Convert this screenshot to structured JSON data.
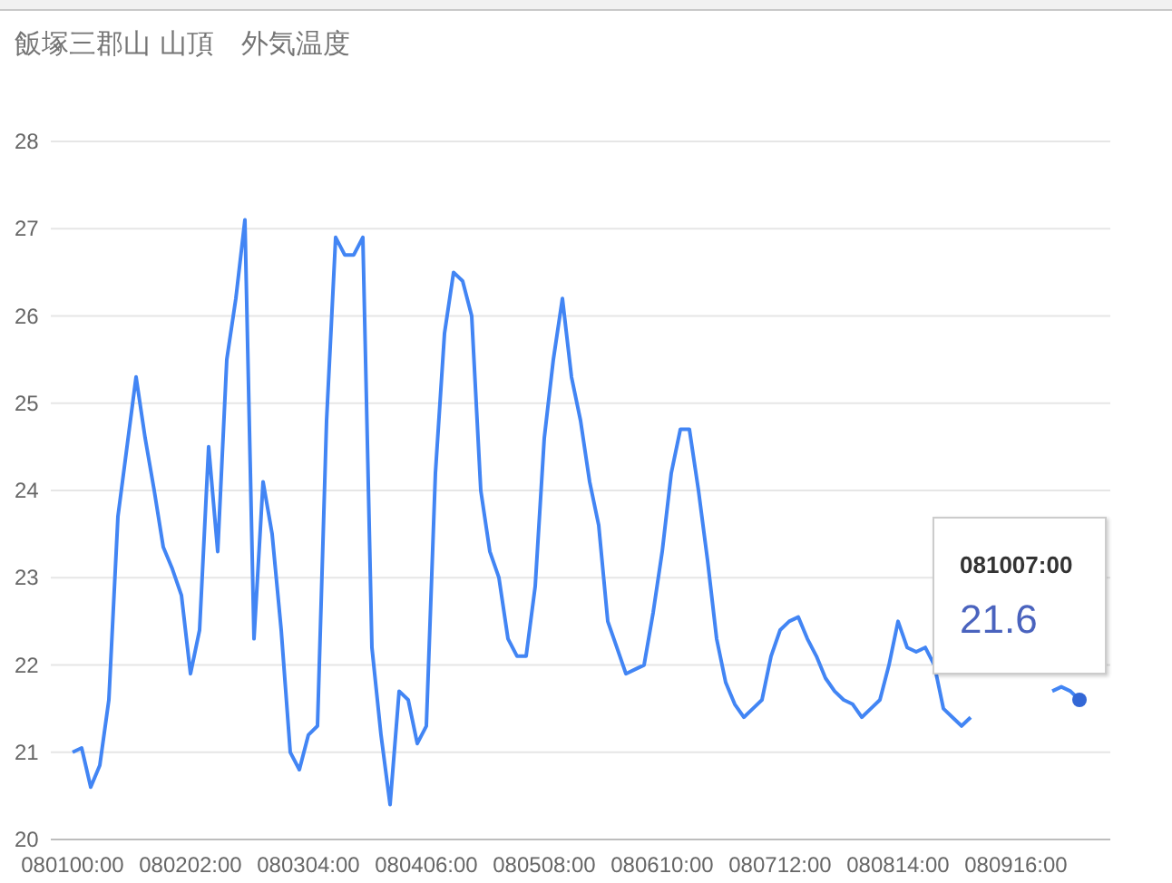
{
  "title": "飯塚三郡山 山頂　外気温度",
  "chart": {
    "chart_data": {
      "type": "line",
      "categories": [
        "080100:00",
        null,
        null,
        null,
        null,
        null,
        null,
        null,
        null,
        null,
        null,
        null,
        null,
        "080202:00",
        null,
        null,
        null,
        null,
        null,
        null,
        null,
        null,
        null,
        null,
        null,
        null,
        "080304:00",
        null,
        null,
        null,
        null,
        null,
        null,
        null,
        null,
        null,
        null,
        null,
        null,
        "080406:00",
        null,
        null,
        null,
        null,
        null,
        null,
        null,
        null,
        null,
        null,
        null,
        null,
        "080508:00",
        null,
        null,
        null,
        null,
        null,
        null,
        null,
        null,
        null,
        null,
        null,
        null,
        "080610:00",
        null,
        null,
        null,
        null,
        null,
        null,
        null,
        null,
        null,
        null,
        null,
        null,
        "080712:00",
        null,
        null,
        null,
        null,
        null,
        null,
        null,
        null,
        null,
        null,
        null,
        null,
        "080814:00",
        null,
        null,
        null,
        null,
        null,
        null,
        null,
        null,
        null,
        null,
        null,
        null,
        "080916:00",
        null,
        null,
        null,
        null,
        null,
        null,
        null
      ],
      "series": [
        {
          "color": "#4285f4",
          "values": [
            21.0,
            21.05,
            20.6,
            20.85,
            21.6,
            23.7,
            24.5,
            25.3,
            24.6,
            24.0,
            23.35,
            23.1,
            22.8,
            21.9,
            22.4,
            24.5,
            23.3,
            25.5,
            26.2,
            27.1,
            22.3,
            24.1,
            23.5,
            22.4,
            21.0,
            20.8,
            21.2,
            21.3,
            24.8,
            26.9,
            26.7,
            26.7,
            26.9,
            22.2,
            21.2,
            20.4,
            21.7,
            21.6,
            21.1,
            21.3,
            24.2,
            25.8,
            26.5,
            26.4,
            26.0,
            24.0,
            23.3,
            23.0,
            22.3,
            22.1,
            22.1,
            22.9,
            24.6,
            25.5,
            26.2,
            25.3,
            24.8,
            24.1,
            23.6,
            22.5,
            22.2,
            21.9,
            21.95,
            22.0,
            22.6,
            23.3,
            24.2,
            24.7,
            24.7,
            24.0,
            23.2,
            22.3,
            21.8,
            21.55,
            21.4,
            21.5,
            21.6,
            22.1,
            22.4,
            22.5,
            22.55,
            22.3,
            22.1,
            21.85,
            21.7,
            21.6,
            21.55,
            21.4,
            21.5,
            21.6,
            22.0,
            22.5,
            22.2,
            22.15,
            22.2,
            22.0,
            21.5,
            21.4,
            21.3,
            21.4,
            null,
            null,
            null,
            null,
            null,
            null,
            null,
            null,
            21.7,
            21.75,
            21.7,
            21.6
          ]
        }
      ],
      "ylim": [
        20,
        28
      ],
      "grid": true,
      "yticks": [
        20,
        21,
        22,
        23,
        24,
        25,
        26,
        27,
        28
      ]
    },
    "tooltip": {
      "title": "081007:00",
      "value": "21.6"
    }
  }
}
